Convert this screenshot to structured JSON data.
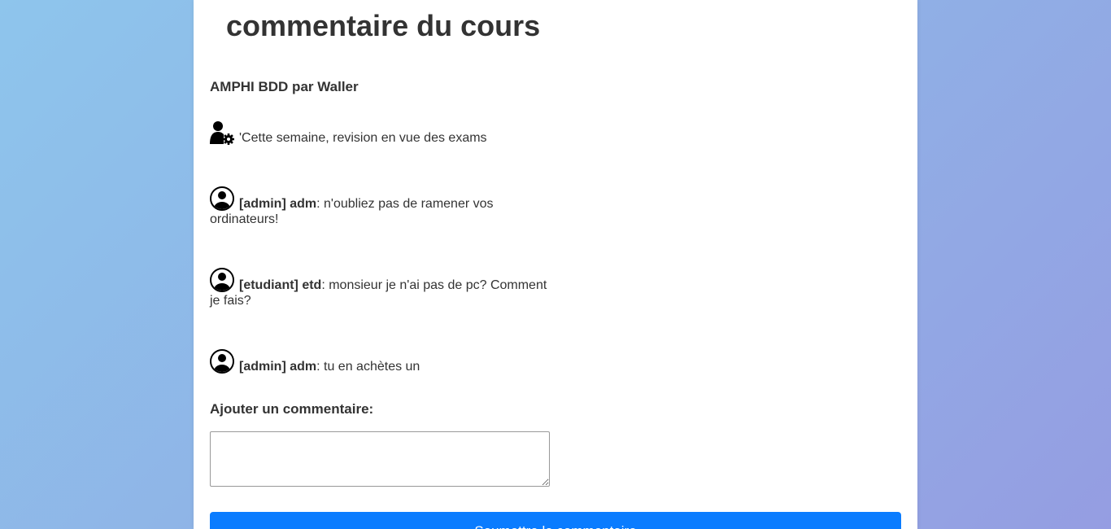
{
  "page": {
    "title": "commentaire du cours"
  },
  "course": {
    "heading": "AMPHI BDD par Waller"
  },
  "comments": [
    {
      "icon": "user-gear-icon",
      "author": "",
      "text": "'Cette semaine, revision en vue des exams"
    },
    {
      "icon": "user-circle-icon",
      "author": "[admin] adm",
      "text": ": n'oubliez pas de ramener vos ordinateurs!"
    },
    {
      "icon": "user-circle-icon",
      "author": "[etudiant] etd",
      "text": ": monsieur je n'ai pas de pc? Comment je fais?"
    },
    {
      "icon": "user-circle-icon",
      "author": "[admin] adm",
      "text": ": tu en achètes un"
    }
  ],
  "form": {
    "label": "Ajouter un commentaire:",
    "textarea_value": "",
    "submit_label": "Soumettre le commentaire"
  },
  "colors": {
    "accent": "#0a7cff",
    "text": "#333333",
    "background_start": "#8ec5ec",
    "background_end": "#959de2"
  }
}
